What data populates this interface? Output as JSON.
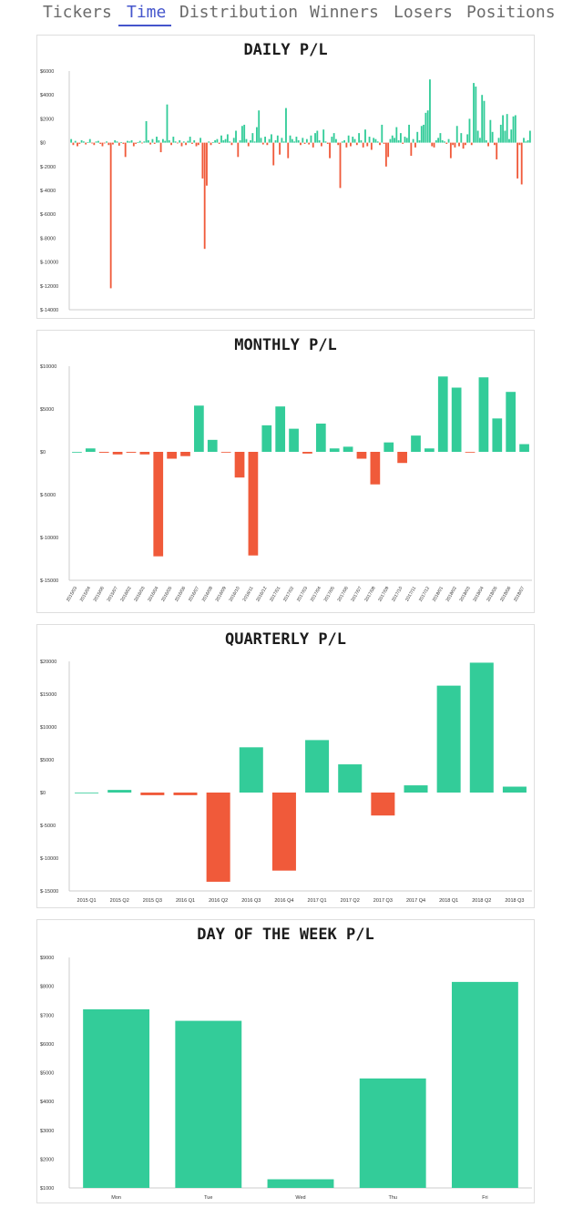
{
  "nav": {
    "tabs": [
      {
        "label": "Tickers"
      },
      {
        "label": "Time",
        "active": true
      },
      {
        "label": "Distribution"
      },
      {
        "label": "Winners"
      },
      {
        "label": "Losers"
      },
      {
        "label": "Positions"
      }
    ]
  },
  "colors": {
    "positive": "#33cc99",
    "negative": "#f05a3a",
    "tab_active": "#4455cc",
    "tab_inactive": "#6b6b6b"
  },
  "chart_data": [
    {
      "type": "bar",
      "title": "DAILY P/L",
      "xlabel": "",
      "ylabel": "",
      "ylim": [
        -14000,
        6000
      ],
      "yticks": [
        6000,
        4000,
        2000,
        0,
        -2000,
        -4000,
        -6000,
        -8000,
        -10000,
        -12000,
        -14000
      ],
      "ytick_labels": [
        "$6000",
        "$4000",
        "$2000",
        "$0",
        "$-2000",
        "$-4000",
        "$-6000",
        "$-8000",
        "$-10000",
        "$-12000",
        "$-14000"
      ],
      "grid": false,
      "values": [
        300,
        -200,
        150,
        -300,
        -100,
        200,
        100,
        -150,
        50,
        300,
        -50,
        -200,
        100,
        150,
        -100,
        -300,
        -50,
        100,
        -200,
        -12200,
        -150,
        200,
        100,
        -250,
        50,
        -100,
        -1200,
        150,
        100,
        200,
        -300,
        -100,
        50,
        150,
        -50,
        100,
        1800,
        200,
        -150,
        300,
        -100,
        500,
        200,
        -800,
        300,
        150,
        3200,
        200,
        -200,
        500,
        100,
        -50,
        200,
        -300,
        100,
        -200,
        150,
        500,
        -100,
        200,
        -300,
        -200,
        400,
        -3000,
        -8900,
        -3600,
        100,
        -200,
        50,
        200,
        300,
        -100,
        600,
        200,
        300,
        700,
        100,
        -200,
        400,
        1000,
        -1200,
        200,
        1400,
        1500,
        300,
        -300,
        200,
        800,
        100,
        1300,
        2700,
        400,
        -150,
        500,
        -200,
        300,
        700,
        -1900,
        200,
        600,
        -1000,
        400,
        100,
        2900,
        -1300,
        600,
        300,
        100,
        500,
        200,
        -200,
        400,
        -100,
        300,
        -150,
        600,
        -400,
        800,
        1000,
        200,
        -300,
        1100,
        100,
        -100,
        -1300,
        500,
        800,
        300,
        -200,
        -3800,
        100,
        200,
        -400,
        600,
        -300,
        500,
        300,
        -200,
        800,
        200,
        -400,
        1100,
        -300,
        500,
        -600,
        400,
        300,
        100,
        -200,
        1500,
        -100,
        -2000,
        -1200,
        300,
        600,
        400,
        1300,
        200,
        800,
        -100,
        500,
        400,
        1500,
        -1100,
        300,
        -400,
        900,
        200,
        1400,
        1500,
        2500,
        2700,
        5300,
        -300,
        -400,
        200,
        400,
        800,
        200,
        100,
        -100,
        300,
        -1300,
        -200,
        -400,
        1400,
        -300,
        800,
        -500,
        -200,
        700,
        2000,
        -200,
        5000,
        4700,
        1000,
        400,
        4000,
        3500,
        200,
        -300,
        1900,
        900,
        -200,
        -1400,
        400,
        1500,
        2300,
        1000,
        2400,
        300,
        1100,
        2200,
        2300,
        -3000,
        -200,
        -3500,
        400,
        100,
        200,
        1000
      ]
    },
    {
      "type": "bar",
      "title": "MONTHLY P/L",
      "xlabel": "",
      "ylabel": "",
      "ylim": [
        -15000,
        10000
      ],
      "yticks": [
        10000,
        5000,
        0,
        -5000,
        -10000,
        -15000
      ],
      "ytick_labels": [
        "$10000",
        "$5000",
        "$0",
        "$-5000",
        "$-10000",
        "$-15000"
      ],
      "grid": false,
      "categories": [
        "2015/03",
        "2015/04",
        "2015/06",
        "2015/07",
        "2016/02",
        "2016/03",
        "2016/04",
        "2016/05",
        "2016/06",
        "2016/07",
        "2016/08",
        "2016/09",
        "2016/10",
        "2016/11",
        "2016/12",
        "2017/01",
        "2017/02",
        "2017/03",
        "2017/04",
        "2017/05",
        "2017/06",
        "2017/07",
        "2017/08",
        "2017/09",
        "2017/10",
        "2017/11",
        "2017/12",
        "2018/01",
        "2018/02",
        "2018/03",
        "2018/04",
        "2018/05",
        "2018/06",
        "2018/07"
      ],
      "values": [
        0,
        400,
        -100,
        -300,
        -100,
        -300,
        -12200,
        -800,
        -500,
        5400,
        1400,
        -50,
        -3000,
        -12100,
        3100,
        5300,
        2700,
        -200,
        3300,
        400,
        600,
        -800,
        -3800,
        1100,
        -1300,
        1900,
        400,
        8800,
        7500,
        -50,
        8700,
        3900,
        7000,
        900
      ]
    },
    {
      "type": "bar",
      "title": "QUARTERLY P/L",
      "xlabel": "",
      "ylabel": "",
      "ylim": [
        -15000,
        20000
      ],
      "yticks": [
        20000,
        15000,
        10000,
        5000,
        0,
        -5000,
        -10000,
        -15000
      ],
      "ytick_labels": [
        "$20000",
        "$15000",
        "$10000",
        "$5000",
        "$0",
        "$-5000",
        "$-10000",
        "$-15000"
      ],
      "grid": false,
      "categories": [
        "2015 Q1",
        "2015 Q2",
        "2015 Q3",
        "2016 Q1",
        "2016 Q2",
        "2016 Q3",
        "2016 Q4",
        "2017 Q1",
        "2017 Q2",
        "2017 Q3",
        "2017 Q4",
        "2018 Q1",
        "2018 Q2",
        "2018 Q3"
      ],
      "values": [
        0,
        400,
        -400,
        -400,
        -13600,
        6900,
        -11900,
        8000,
        4300,
        -3500,
        1100,
        16300,
        19800,
        900
      ]
    },
    {
      "type": "bar",
      "title": "DAY OF THE WEEK P/L",
      "xlabel": "",
      "ylabel": "",
      "ylim": [
        1000,
        9000
      ],
      "yticks": [
        9000,
        8000,
        7000,
        6000,
        5000,
        4000,
        3000,
        2000,
        1000
      ],
      "ytick_labels": [
        "$9000",
        "$8000",
        "$7000",
        "$6000",
        "$5000",
        "$4000",
        "$3000",
        "$2000",
        "$1000"
      ],
      "grid": false,
      "categories": [
        "Mon",
        "Tue",
        "Wed",
        "Thu",
        "Fri"
      ],
      "values": [
        7200,
        6800,
        1300,
        4800,
        8150
      ]
    }
  ]
}
